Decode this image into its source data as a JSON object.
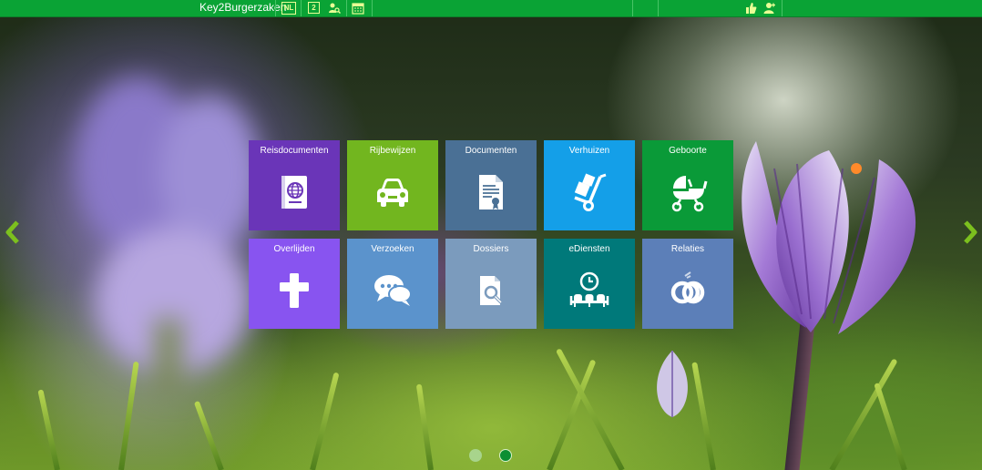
{
  "app": {
    "title": "Key2Burgerzaken"
  },
  "toolbar": {
    "language": "NL",
    "counter": "2",
    "icons": [
      "user-search-icon",
      "calendar-icon",
      "thumbs-up-icon",
      "user-icon"
    ]
  },
  "colors": {
    "topbar": "#0aa335",
    "icon_tint": "#e9ff95"
  },
  "tiles": [
    {
      "label": "Reisdocumenten",
      "icon": "passport-icon",
      "color": "#6a35b8"
    },
    {
      "label": "Rijbewijzen",
      "icon": "car-icon",
      "color": "#72b61f"
    },
    {
      "label": "Documenten",
      "icon": "certificate-document-icon",
      "color": "#4a7095"
    },
    {
      "label": "Verhuizen",
      "icon": "hand-truck-icon",
      "color": "#149fe8"
    },
    {
      "label": "Geboorte",
      "icon": "stroller-icon",
      "color": "#0a9a38"
    },
    {
      "label": "Overlijden",
      "icon": "cross-icon",
      "color": "#8854f0"
    },
    {
      "label": "Verzoeken",
      "icon": "chat-bubbles-icon",
      "color": "#5b93cc"
    },
    {
      "label": "Dossiers",
      "icon": "document-search-icon",
      "color": "#7b9bbd"
    },
    {
      "label": "eDiensten",
      "icon": "waiting-room-clock-icon",
      "color": "#00797a"
    },
    {
      "label": "Relaties",
      "icon": "linked-rings-icon",
      "color": "#5c7fb8"
    }
  ],
  "carousel": {
    "pages": 2,
    "active_page": 2,
    "prev_icon": "chevron-left-icon",
    "next_icon": "chevron-right-icon"
  }
}
